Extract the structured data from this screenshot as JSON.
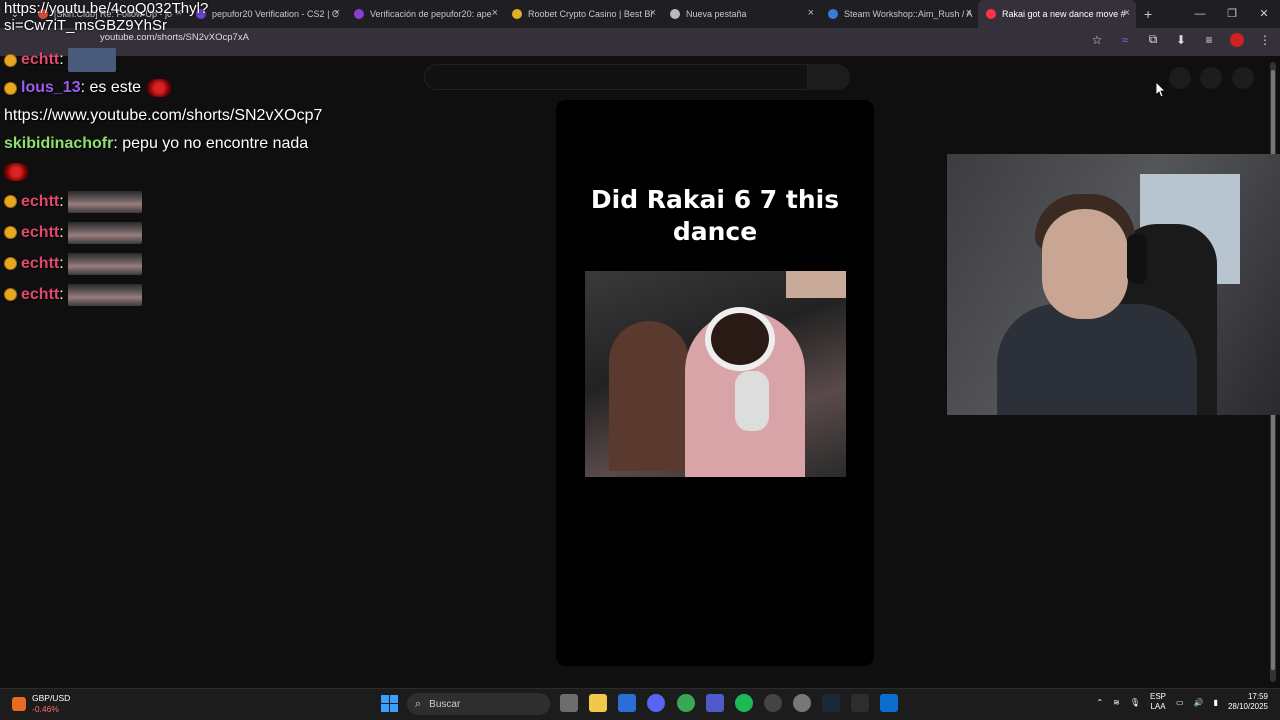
{
  "browser": {
    "tabs": [
      {
        "label": "[Skin.Club] Re: Follow-Up - jo",
        "icon_color": "#d44a3a"
      },
      {
        "label": "pepufor20 Verification - CS2 | C",
        "icon_color": "#6b3fd0"
      },
      {
        "label": "Verificación de pepufor20: ape",
        "icon_color": "#8b3fd0"
      },
      {
        "label": "Roobet Crypto Casino | Best Bi",
        "icon_color": "#e0b020"
      },
      {
        "label": "Nueva pestaña",
        "icon_color": "#bbbbbb"
      },
      {
        "label": "Steam Workshop::Aim_Rush / A",
        "icon_color": "#3d7ad6"
      },
      {
        "label": "Rakai got a new dance move #",
        "icon_color": "#ff3344",
        "active": true
      }
    ],
    "address": "youtube.com/shorts/SN2vXOcp7xA"
  },
  "chat": {
    "overflow_lines": [
      "https://youtu.be/4coQ032Thyl?",
      "si=Cw7iT_msGBZ9YhSr"
    ],
    "messages": [
      {
        "user": "echtt",
        "user_color": "#e04a6a",
        "badge": true,
        "text": ":",
        "emote": "image"
      },
      {
        "user": "lous_13",
        "user_color": "#9b5cf0",
        "badge": true,
        "text": ": es este",
        "emote": "small"
      },
      {
        "user": "",
        "user_color": "#ffffff",
        "badge": false,
        "text": "https://www.youtube.com/shorts/SN2vXOcp7",
        "emote": ""
      },
      {
        "user": "skibidinachofr",
        "user_color": "#8fe070",
        "badge": false,
        "text": ": pepu yo no encontre nada",
        "emote": ""
      },
      {
        "user": "",
        "user_color": "#ffffff",
        "badge": false,
        "text": "",
        "emote": "small"
      },
      {
        "user": "echtt",
        "user_color": "#e04a6a",
        "badge": true,
        "text": ":",
        "emote": "car"
      },
      {
        "user": "echtt",
        "user_color": "#e04a6a",
        "badge": true,
        "text": ":",
        "emote": "car"
      },
      {
        "user": "echtt",
        "user_color": "#e04a6a",
        "badge": true,
        "text": ":",
        "emote": "car"
      },
      {
        "user": "echtt",
        "user_color": "#e04a6a",
        "badge": true,
        "text": ":",
        "emote": "car"
      }
    ]
  },
  "short": {
    "title_line1": "Did Rakai 6 7 this",
    "title_line2": "dance"
  },
  "taskbar": {
    "weather_title": "GBP/USD",
    "weather_change": "-0.46%",
    "search_placeholder": "Buscar",
    "lang_line1": "ESP",
    "lang_line2": "LAA",
    "time": "17:59",
    "date": "28/10/2025"
  },
  "icons": {
    "tab_close": "×",
    "new_tab": "+",
    "minimize": "—",
    "maximize": "❐",
    "close": "✕",
    "star": "☆",
    "extensions": "⧉",
    "download": "⬇",
    "menu": "⋮",
    "search": "⌕"
  }
}
